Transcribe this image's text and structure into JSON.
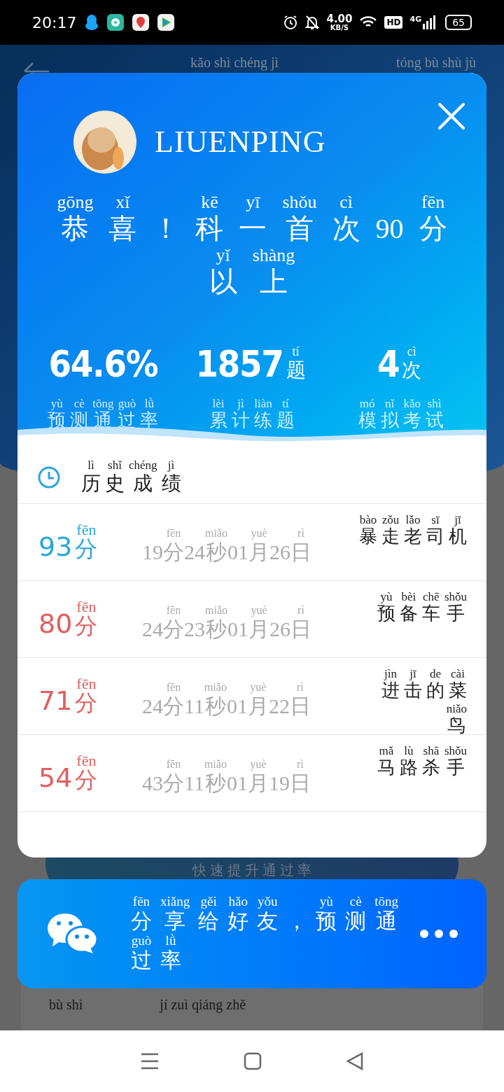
{
  "status_bar": {
    "time": "20:17",
    "speed": "4.00",
    "speed_unit": "KB/S",
    "hd": "HD",
    "network": "4G",
    "battery": "65"
  },
  "background": {
    "header_pinyin": [
      "kǎo shì chéng jì",
      "tóng bù shù jù"
    ],
    "button": "快 速 提 升 通 过 率",
    "footer_pinyin": [
      "bù shì",
      "jí zuì qiáng zhě"
    ]
  },
  "modal": {
    "username": "LIUENPING",
    "headline": [
      [
        "gōng",
        "恭"
      ],
      [
        "xǐ",
        "喜"
      ],
      "！",
      [
        "kē",
        "科"
      ],
      [
        "yī",
        "一"
      ],
      [
        "shǒu",
        "首"
      ],
      [
        "cì",
        "次"
      ],
      "90",
      [
        "fēn",
        "分"
      ],
      [
        "yǐ",
        "以"
      ],
      [
        "shàng",
        "上"
      ]
    ],
    "stats": [
      {
        "value": "64.6%",
        "label": [
          [
            "yù",
            "预"
          ],
          [
            "cè",
            "测"
          ],
          [
            "tōng",
            "通"
          ],
          [
            "guò",
            "过"
          ],
          [
            "lǜ",
            "率"
          ]
        ]
      },
      {
        "value": "1857",
        "unit": [
          "tí",
          "题"
        ],
        "label": [
          [
            "lèi",
            "累"
          ],
          [
            "jì",
            "计"
          ],
          [
            "liàn",
            "练"
          ],
          [
            "tí",
            "题"
          ]
        ]
      },
      {
        "value": "4",
        "unit": [
          "cì",
          "次"
        ],
        "label": [
          [
            "mó",
            "模"
          ],
          [
            "nǐ",
            "拟"
          ],
          [
            "kǎo",
            "考"
          ],
          [
            "shì",
            "试"
          ]
        ]
      }
    ],
    "history_title": [
      [
        "lì",
        "历"
      ],
      [
        "shǐ",
        "史"
      ],
      [
        "chéng",
        "成"
      ],
      [
        "jì",
        "绩"
      ]
    ],
    "records": [
      {
        "score": "93",
        "unit": [
          "fēn",
          "分"
        ],
        "color": "#2aa7dc",
        "time": [
          "19",
          [
            "fēn",
            "分"
          ],
          "24",
          [
            "miǎo",
            "秒"
          ],
          "01",
          [
            "yuè",
            "月"
          ],
          "26",
          [
            "rì",
            "日"
          ]
        ],
        "nickname": [
          [
            "bào",
            "暴"
          ],
          [
            "zǒu",
            "走"
          ],
          [
            "lǎo",
            "老"
          ],
          [
            "sī",
            "司"
          ],
          [
            "jī",
            "机"
          ]
        ]
      },
      {
        "score": "80",
        "unit": [
          "fēn",
          "分"
        ],
        "color": "#e06060",
        "time": [
          "24",
          [
            "fēn",
            "分"
          ],
          "23",
          [
            "miǎo",
            "秒"
          ],
          "01",
          [
            "yuè",
            "月"
          ],
          "26",
          [
            "rì",
            "日"
          ]
        ],
        "nickname": [
          [
            "yù",
            "预"
          ],
          [
            "bèi",
            "备"
          ],
          [
            "chē",
            "车"
          ],
          [
            "shǒu",
            "手"
          ]
        ]
      },
      {
        "score": "71",
        "unit": [
          "fēn",
          "分"
        ],
        "color": "#e06060",
        "time": [
          "24",
          [
            "fēn",
            "分"
          ],
          "11",
          [
            "miǎo",
            "秒"
          ],
          "01",
          [
            "yuè",
            "月"
          ],
          "22",
          [
            "rì",
            "日"
          ]
        ],
        "nickname": [
          [
            "jìn",
            "进"
          ],
          [
            "jī",
            "击"
          ],
          [
            "de",
            "的"
          ],
          [
            "cài",
            "菜"
          ],
          [
            "niǎo",
            "鸟"
          ]
        ]
      },
      {
        "score": "54",
        "unit": [
          "fēn",
          "分"
        ],
        "color": "#e06060",
        "time": [
          "43",
          [
            "fēn",
            "分"
          ],
          "11",
          [
            "miǎo",
            "秒"
          ],
          "01",
          [
            "yuè",
            "月"
          ],
          "19",
          [
            "rì",
            "日"
          ]
        ],
        "nickname": [
          [
            "mǎ",
            "马"
          ],
          [
            "lù",
            "路"
          ],
          [
            "shā",
            "杀"
          ],
          [
            "shǒu",
            "手"
          ]
        ]
      }
    ]
  },
  "share": {
    "text": [
      [
        "fēn",
        "分"
      ],
      [
        "xiǎng",
        "享"
      ],
      [
        "gěi",
        "给"
      ],
      [
        "hǎo",
        "好"
      ],
      [
        "yǒu",
        "友"
      ],
      "，",
      [
        "yù",
        "预"
      ],
      [
        "cè",
        "测"
      ],
      [
        "tōng",
        "通"
      ],
      [
        "guò",
        "过"
      ],
      [
        "lǜ",
        "率"
      ]
    ]
  }
}
